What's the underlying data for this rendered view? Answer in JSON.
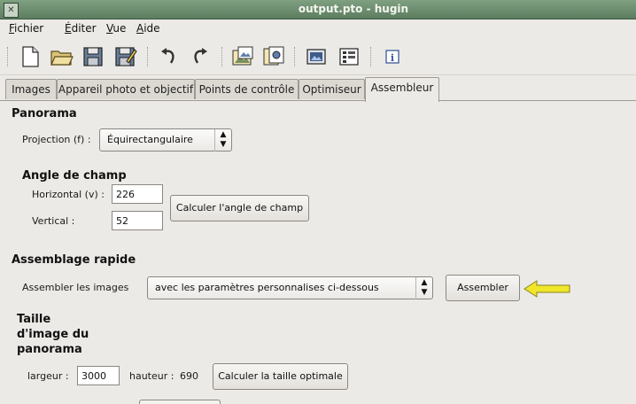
{
  "window": {
    "title": "output.pto - hugin",
    "icon": "window-menu-icon"
  },
  "menubar": {
    "items": [
      {
        "mnemonic": "F",
        "rest": "ichier"
      },
      {
        "mnemonic": "É",
        "rest": "diter"
      },
      {
        "mnemonic": "V",
        "rest": "ue"
      },
      {
        "mnemonic": "A",
        "rest": "ide"
      }
    ]
  },
  "toolbar": {
    "icons": [
      "new-file-icon",
      "open-folder-icon",
      "save-icon",
      "save-as-icon",
      "undo-icon",
      "redo-icon",
      "add-image-icon",
      "add-series-icon",
      "preview-icon",
      "optimize-icon",
      "info-icon"
    ]
  },
  "tabs": [
    {
      "label": "Images"
    },
    {
      "label": "Appareil photo et objectif"
    },
    {
      "label": "Points de contrôle"
    },
    {
      "label": "Optimiseur"
    },
    {
      "label": "Assembleur",
      "active": true
    }
  ],
  "panorama": {
    "heading": "Panorama",
    "projection_label": "Projection (f) :",
    "projection_value": "Équirectangulaire"
  },
  "fov": {
    "heading": "Angle de champ",
    "horizontal_label": "Horizontal (v) :",
    "horizontal_value": "226",
    "vertical_label": "Vertical :",
    "vertical_value": "52",
    "calc_button": "Calculer l'angle de champ"
  },
  "quick_stitch": {
    "heading": "Assemblage rapide",
    "label": "Assembler les images",
    "mode_value": "avec les paramètres personnalises ci-dessous",
    "stitch_button": "Assembler"
  },
  "size": {
    "heading_line1": "Taille",
    "heading_line2": "d'image du",
    "heading_line3": "panorama",
    "width_label": "largeur :",
    "width_value": "3000",
    "height_label": "hauteur :",
    "height_value": "690",
    "calc_button": "Calculer la taille optimale"
  },
  "colors": {
    "titlebar": "#6e8f70",
    "arrow": "#f0e62a"
  }
}
